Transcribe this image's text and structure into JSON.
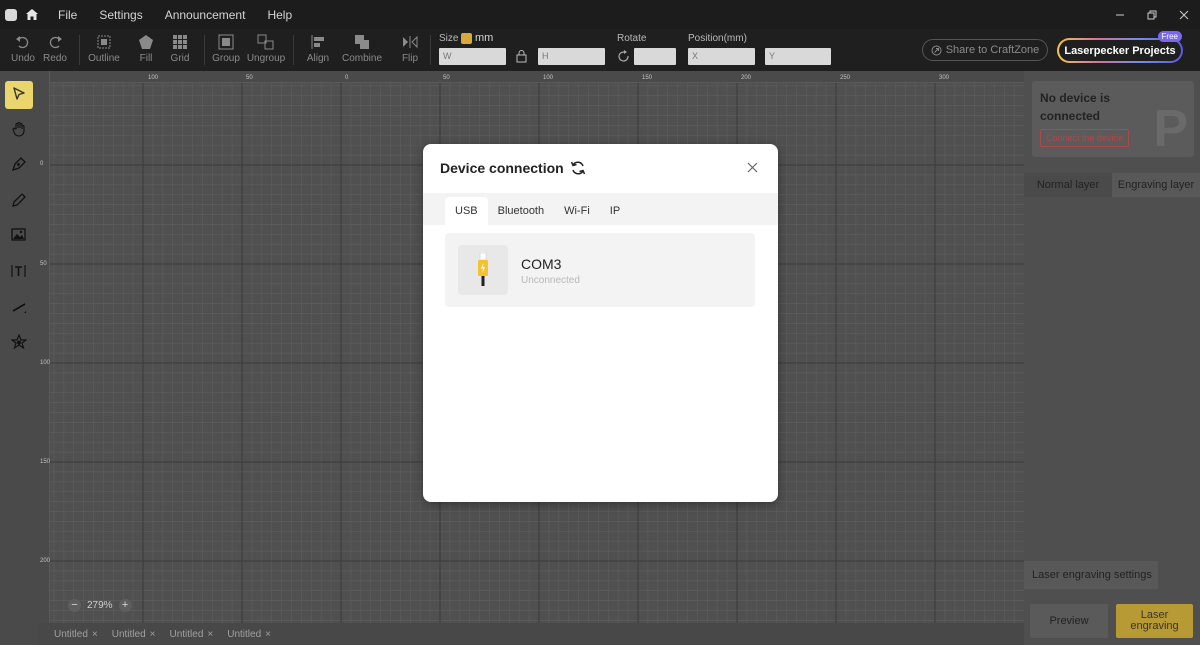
{
  "menu": {
    "items": [
      "File",
      "Settings",
      "Announcement",
      "Help"
    ]
  },
  "toolbar": {
    "undo": "Undo",
    "redo": "Redo",
    "outline": "Outline",
    "fill": "Fill",
    "grid": "Grid",
    "group": "Group",
    "ungroup": "Ungroup",
    "align": "Align",
    "combine": "Combine",
    "flip": "Flip",
    "size_label": "Size",
    "size_unit": "mm",
    "rotate_label": "Rotate",
    "position_label": "Position(mm)",
    "w_placeholder": "W",
    "h_placeholder": "H",
    "x_placeholder": "X",
    "y_placeholder": "Y",
    "share_label": "Share to CraftZone",
    "projects_label": "Laserpecker Projects",
    "free_badge": "Free"
  },
  "canvas": {
    "ruler_top": [
      "100",
      "50",
      "0",
      "50",
      "100",
      "150",
      "200",
      "250",
      "300"
    ],
    "ruler_left": [
      "0",
      "50",
      "100",
      "150",
      "200"
    ],
    "zoom_level": "279%"
  },
  "doc_tabs": [
    "Untitled",
    "Untitled",
    "Untitled",
    "Untitled"
  ],
  "right_panel": {
    "device_status": "No device is connected",
    "connect_button": "Connect the device",
    "layer_tabs": [
      "Normal layer",
      "Engraving layer"
    ],
    "engrave_settings": "Laser engraving settings",
    "preview_button": "Preview",
    "engrave_button": "Laser engraving"
  },
  "modal": {
    "title": "Device connection",
    "tabs": [
      "USB",
      "Bluetooth",
      "Wi-Fi",
      "IP"
    ],
    "active_tab": "USB",
    "port": {
      "name": "COM3",
      "status": "Unconnected"
    }
  },
  "colors": {
    "accent": "#ead66d",
    "engrave_button": "#b89a35",
    "connect_red": "#b04848",
    "usb_yellow": "#f2c230"
  }
}
